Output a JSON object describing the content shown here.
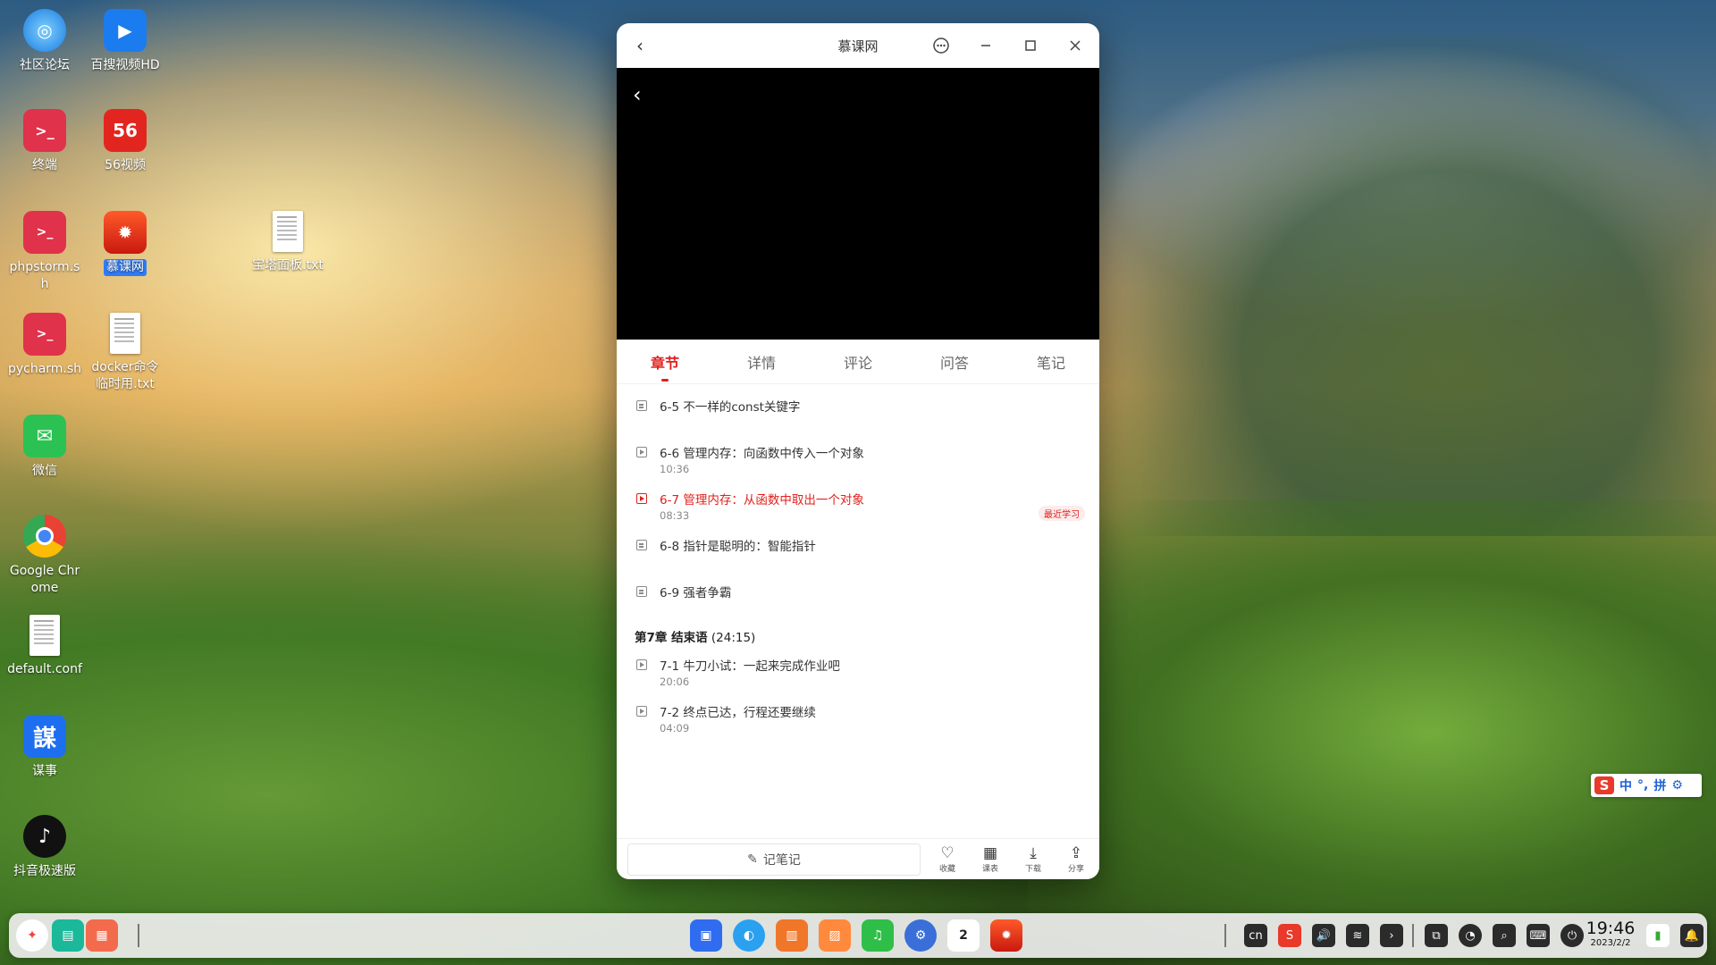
{
  "desktop": {
    "icons": [
      {
        "label": "社区论坛"
      },
      {
        "label": "百搜视频HD"
      },
      {
        "label": "终端"
      },
      {
        "label": "56视频",
        "mark": "56"
      },
      {
        "label": "phpstorm.sh"
      },
      {
        "label": "慕课网"
      },
      {
        "label": "宝塔面板.txt"
      },
      {
        "label": "pycharm.sh"
      },
      {
        "label": "docker命令临时用.txt"
      },
      {
        "label": "微信"
      },
      {
        "label": "Google Chrome"
      },
      {
        "label": "default.conf"
      },
      {
        "label": "谋事",
        "mark": "謀"
      },
      {
        "label": "抖音极速版"
      }
    ]
  },
  "window": {
    "title": "慕课网",
    "tabs": [
      "章节",
      "详情",
      "评论",
      "问答",
      "笔记"
    ],
    "lessons": [
      {
        "title": "6-5 不一样的const关键字",
        "duration": ""
      },
      {
        "title": "6-6 管理内存：向函数中传入一个对象",
        "duration": "10:36"
      },
      {
        "title": "6-7 管理内存：从函数中取出一个对象",
        "duration": "08:33",
        "badge": "最近学习"
      },
      {
        "title": "6-8 指针是聪明的：智能指针",
        "duration": ""
      },
      {
        "title": "6-9 强者争霸",
        "duration": ""
      },
      {
        "title": "7-1 牛刀小试：一起来完成作业吧",
        "duration": "20:06"
      },
      {
        "title": "7-2 终点已达，行程还要继续",
        "duration": "04:09"
      }
    ],
    "chapter7": {
      "name": "第7章 结束语",
      "duration": "(24:15)"
    },
    "bottom": {
      "note_label": "记笔记",
      "actions": [
        "收藏",
        "课表",
        "下载",
        "分享"
      ]
    }
  },
  "ime": {
    "mode": "中",
    "punct": "°,",
    "layout": "拼"
  },
  "taskbar": {
    "lang": "cn",
    "time": "19:46",
    "date": "2023/2/2",
    "calendar_day": "2"
  }
}
